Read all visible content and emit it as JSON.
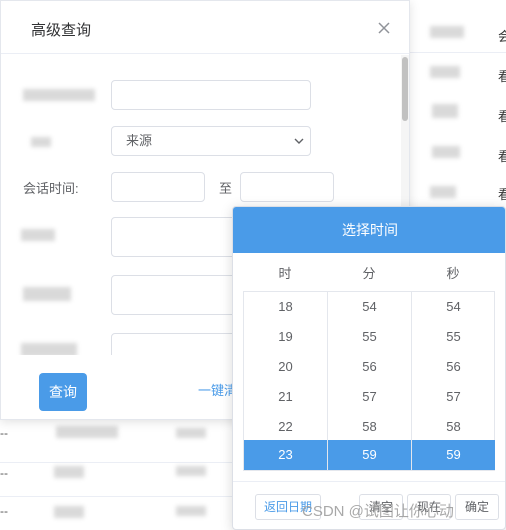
{
  "dialog": {
    "title": "高级查询",
    "source_select": {
      "value": "来源"
    },
    "session_time_label": "会话时间:",
    "to_label": "至",
    "query_button": "查询",
    "clear_link": "一键清"
  },
  "time_picker": {
    "title": "选择时间",
    "columns": [
      "时",
      "分",
      "秒"
    ],
    "hours": [
      "18",
      "19",
      "20",
      "21",
      "22",
      "23"
    ],
    "minutes": [
      "54",
      "55",
      "56",
      "57",
      "58",
      "59"
    ],
    "seconds": [
      "54",
      "55",
      "56",
      "57",
      "58",
      "59"
    ],
    "selected": {
      "hour": "23",
      "minute": "59",
      "second": "59"
    },
    "footer": {
      "back": "返回日期",
      "clear": "清空",
      "now": "现在",
      "confirm": "确定"
    }
  },
  "background": {
    "row_dashes": [
      "--",
      "--",
      "--"
    ],
    "right_chars": [
      "会",
      "看",
      "看",
      "看",
      "看"
    ]
  },
  "watermark": "CSDN @试图让你心动",
  "colors": {
    "primary": "#4a9be8",
    "border": "#dcdfe6",
    "text": "#606266"
  }
}
